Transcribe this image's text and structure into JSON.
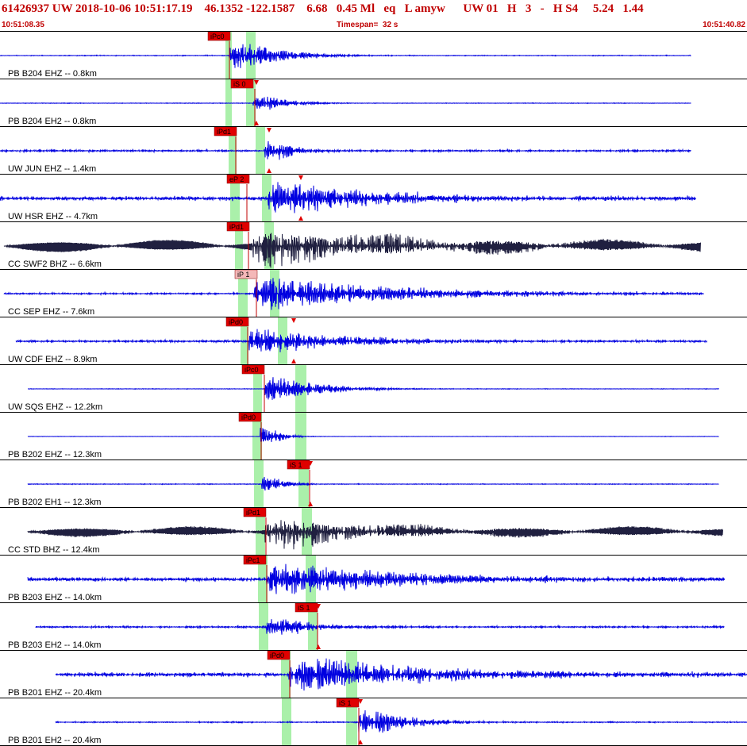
{
  "header": {
    "event_line": "61426937 UW 2018-10-06 10:51:17.19    46.1352 -122.1587    6.68   0.45 Ml   eq   L amyw      UW 01   H   3   -   H S4     5.24   1.44",
    "time_start": "10:51:08.35",
    "time_end": "10:51:40.82",
    "timespan": "Timespan=  32 s"
  },
  "colors": {
    "header_text": "#c00000",
    "trace_blue": "#0000e0",
    "trace_dark": "#202040",
    "pick_window": "#aaf0aa",
    "pick_flag": "#e00000",
    "pick_flag_light": "#f4b8b8",
    "pick_line": "#c00000",
    "marker": "#e00000"
  },
  "traces": [
    {
      "label": "PB B204 EHZ -- 0.8km",
      "color": "blue",
      "picks": [
        {
          "text": "iPc0",
          "style": "solid"
        }
      ],
      "markers": []
    },
    {
      "label": "PB B204 EH2 -- 0.8km",
      "color": "blue",
      "picks": [
        {
          "text": "iS 0",
          "style": "solid"
        }
      ],
      "markers": [
        "down",
        "up"
      ]
    },
    {
      "label": "UW JUN EHZ -- 1.4km",
      "color": "blue",
      "picks": [
        {
          "text": "iPd1",
          "style": "solid"
        }
      ],
      "markers": [
        "down",
        "up"
      ]
    },
    {
      "label": "UW HSR EHZ -- 4.7km",
      "color": "blue",
      "picks": [
        {
          "text": "eP 2",
          "style": "solid"
        }
      ],
      "markers": [
        "down",
        "up"
      ]
    },
    {
      "label": "CC SWF2 BHZ -- 6.6km",
      "color": "dark",
      "picks": [
        {
          "text": "iPd1",
          "style": "solid"
        }
      ],
      "markers": []
    },
    {
      "label": "CC SEP EHZ -- 7.6km",
      "color": "blue",
      "picks": [
        {
          "text": "iP 1",
          "style": "light"
        }
      ],
      "markers": []
    },
    {
      "label": "UW CDF EHZ -- 8.9km",
      "color": "blue",
      "picks": [
        {
          "text": "iPd0",
          "style": "solid"
        }
      ],
      "markers": [
        "down",
        "up"
      ]
    },
    {
      "label": "UW SQS EHZ -- 12.2km",
      "color": "blue",
      "picks": [
        {
          "text": "iPc0",
          "style": "solid"
        }
      ],
      "markers": []
    },
    {
      "label": "PB B202 EHZ -- 12.3km",
      "color": "blue",
      "picks": [
        {
          "text": "iPd0",
          "style": "solid"
        }
      ],
      "markers": []
    },
    {
      "label": "PB B202 EH1 -- 12.3km",
      "color": "blue",
      "picks": [
        {
          "text": "iS 1",
          "style": "solid"
        }
      ],
      "markers": [
        "down",
        "up"
      ]
    },
    {
      "label": "CC STD BHZ -- 12.4km",
      "color": "dark",
      "picks": [
        {
          "text": "iPd1",
          "style": "solid"
        }
      ],
      "markers": []
    },
    {
      "label": "PB B203 EHZ -- 14.0km",
      "color": "blue",
      "picks": [
        {
          "text": "iPc1",
          "style": "solid"
        }
      ],
      "markers": []
    },
    {
      "label": "PB B203 EH2 -- 14.0km",
      "color": "blue",
      "picks": [
        {
          "text": "iS 1",
          "style": "solid"
        }
      ],
      "markers": [
        "down",
        "up"
      ]
    },
    {
      "label": "PB B201 EHZ -- 20.4km",
      "color": "blue",
      "picks": [
        {
          "text": "iPd0",
          "style": "solid"
        }
      ],
      "markers": []
    },
    {
      "label": "PB B201 EH2 -- 20.4km",
      "color": "blue",
      "picks": [
        {
          "text": "iS 1",
          "style": "solid"
        }
      ],
      "markers": [
        "down",
        "up"
      ]
    }
  ]
}
